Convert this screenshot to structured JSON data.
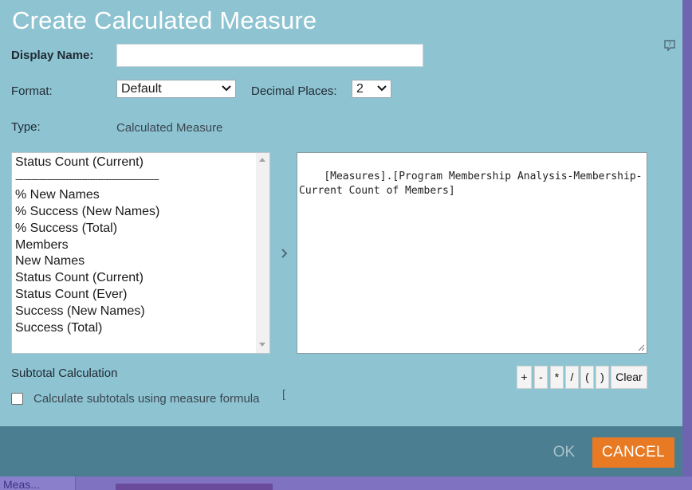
{
  "background": {
    "bottom_tab_label": "Meas..."
  },
  "dialog": {
    "title": "Create Calculated Measure",
    "display_name": {
      "label": "Display Name:",
      "value": ""
    },
    "format": {
      "label": "Format:",
      "selected": "Default"
    },
    "decimal_places": {
      "label": "Decimal Places:",
      "selected": "2"
    },
    "type": {
      "label": "Type:",
      "value": "Calculated Measure"
    },
    "measure_list": {
      "header_item": "Status Count (Current)",
      "separator": "------------------------------------------------------",
      "items": [
        "% New Names",
        "% Success (New Names)",
        "% Success (Total)",
        "Members",
        "New Names",
        "Status Count (Current)",
        "Status Count (Ever)",
        "Success (New Names)",
        "Success (Total)"
      ]
    },
    "formula": "[Measures].[Program Membership Analysis-Membership-Current Count of Members]",
    "subtotal": {
      "title": "Subtotal Calculation",
      "checkbox_label": "Calculate subtotals using measure formula",
      "checked": false,
      "bracket": "["
    },
    "operators": {
      "plus": "+",
      "minus": "-",
      "multiply": "*",
      "divide": "/",
      "open_paren": "(",
      "close_paren": ")",
      "clear": "Clear"
    },
    "buttons": {
      "ok": "OK",
      "cancel": "CANCEL"
    }
  },
  "colors": {
    "dialog_bg": "#8ec3d1",
    "footer_bg": "#4a7e90",
    "cancel_bg": "#e97a24",
    "app_bg": "#7a6fb8"
  },
  "icons": {
    "help": "help-icon",
    "add_arrow": "chevron-right-icon",
    "dropdown": "chevron-down-icon"
  }
}
